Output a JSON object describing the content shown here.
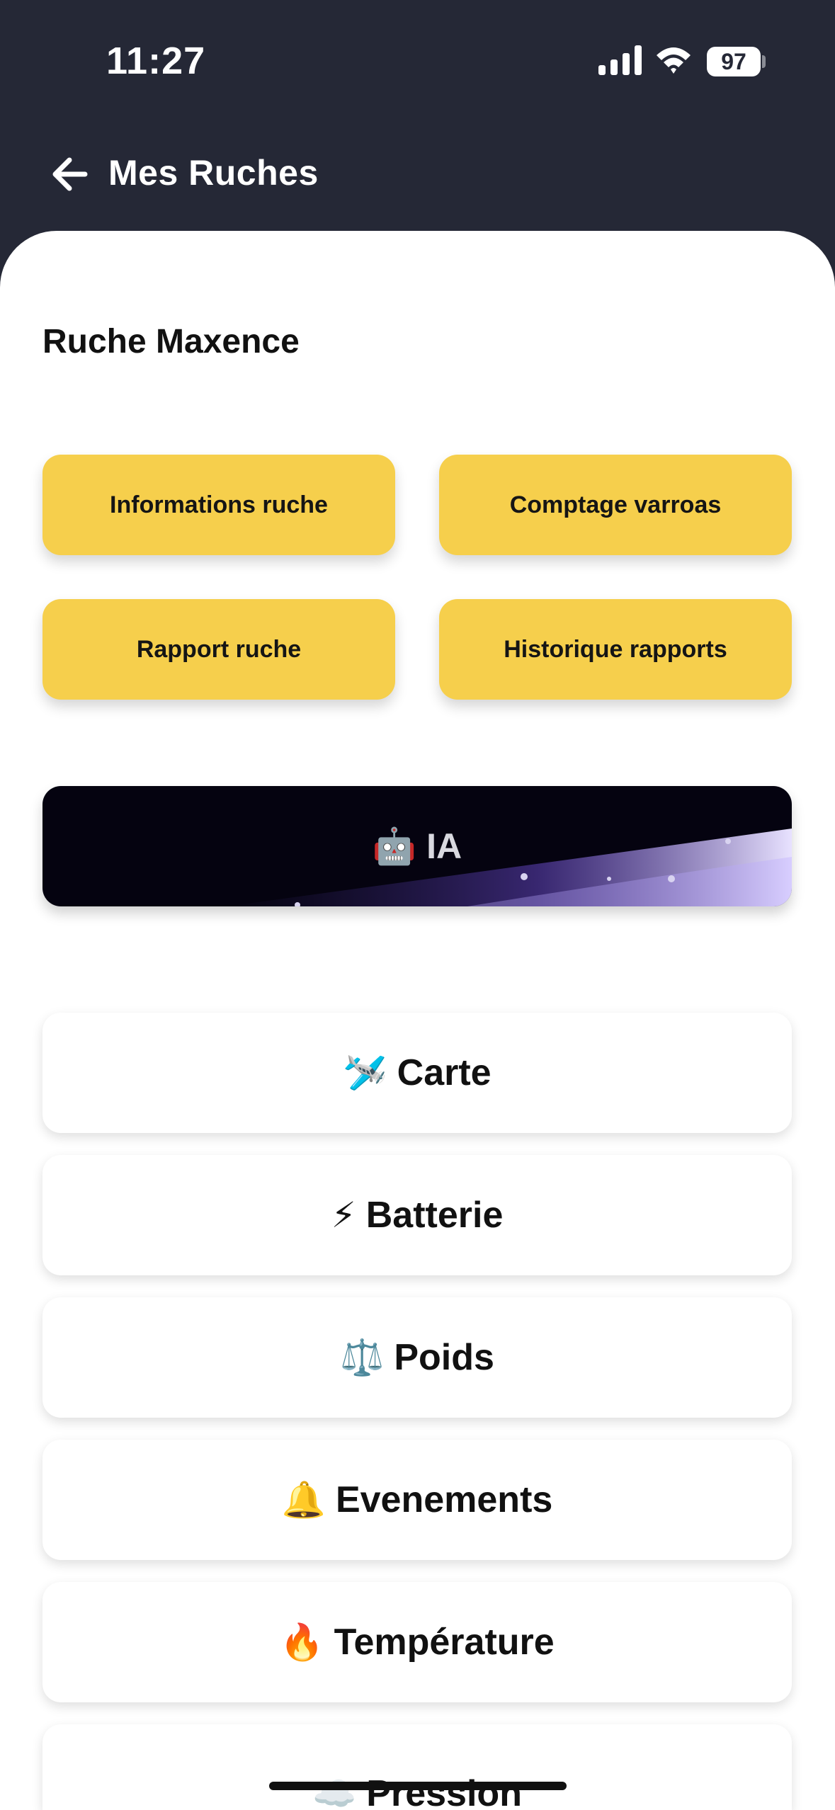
{
  "status_bar": {
    "time": "11:27",
    "battery_level": "97",
    "icons": [
      "cellular-signal-icon",
      "wifi-icon",
      "battery-icon"
    ]
  },
  "nav": {
    "back_icon": "arrow-left-icon",
    "title": "Mes Ruches"
  },
  "hive": {
    "title": "Ruche Maxence"
  },
  "actions": [
    {
      "label": "Informations ruche"
    },
    {
      "label": "Comptage varroas"
    },
    {
      "label": "Rapport ruche"
    },
    {
      "label": "Historique rapports"
    }
  ],
  "ia_button": {
    "emoji": "🤖",
    "label": "IA"
  },
  "menu": [
    {
      "emoji": "🛩️",
      "label": "Carte"
    },
    {
      "emoji": "⚡",
      "label": "Batterie"
    },
    {
      "emoji": "⚖️",
      "label": "Poids"
    },
    {
      "emoji": "🔔",
      "label": "Evenements"
    },
    {
      "emoji": "🔥",
      "label": "Température"
    },
    {
      "emoji": "☁️",
      "label": "Pression"
    }
  ],
  "colors": {
    "header_bg": "#252836",
    "accent_yellow": "#F6CF4C",
    "ia_bg": "#050310",
    "ia_glow": "#7b5cd6"
  }
}
